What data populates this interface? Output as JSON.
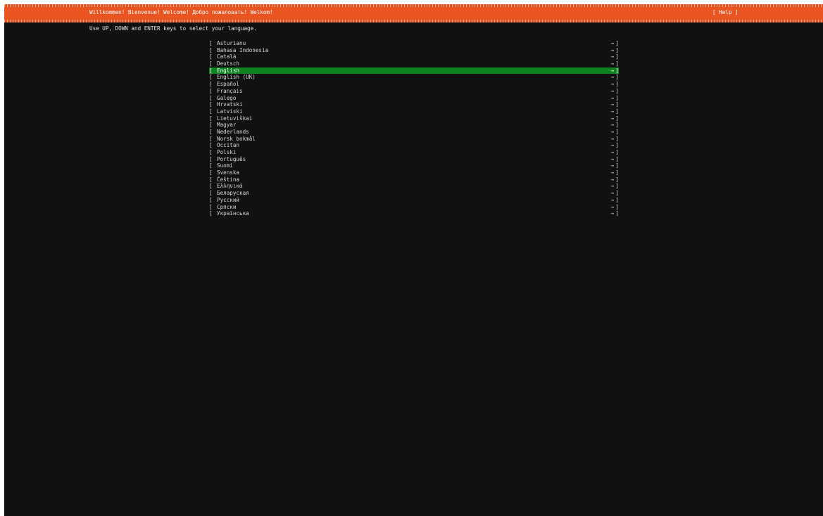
{
  "header": {
    "title": "Willkommen! Bienvenue! Welcome! Добро пожаловать! Welkom!",
    "help_label": "[ Help ]"
  },
  "instructions": "Use UP, DOWN and ENTER keys to select your language.",
  "list_markers": {
    "open_bracket": "[",
    "close_bracket": "]",
    "arrow": "→"
  },
  "languages": [
    {
      "label": "Asturianu",
      "selected": false
    },
    {
      "label": "Bahasa Indonesia",
      "selected": false
    },
    {
      "label": "Català",
      "selected": false
    },
    {
      "label": "Deutsch",
      "selected": false
    },
    {
      "label": "English",
      "selected": true
    },
    {
      "label": "English (UK)",
      "selected": false
    },
    {
      "label": "Español",
      "selected": false
    },
    {
      "label": "Français",
      "selected": false
    },
    {
      "label": "Galego",
      "selected": false
    },
    {
      "label": "Hrvatski",
      "selected": false
    },
    {
      "label": "Latviski",
      "selected": false
    },
    {
      "label": "Lietuviškai",
      "selected": false
    },
    {
      "label": "Magyar",
      "selected": false
    },
    {
      "label": "Nederlands",
      "selected": false
    },
    {
      "label": "Norsk bokmål",
      "selected": false
    },
    {
      "label": "Occitan",
      "selected": false
    },
    {
      "label": "Polski",
      "selected": false
    },
    {
      "label": "Português",
      "selected": false
    },
    {
      "label": "Suomi",
      "selected": false
    },
    {
      "label": "Svenska",
      "selected": false
    },
    {
      "label": "Čeština",
      "selected": false
    },
    {
      "label": "Ελληνικά",
      "selected": false
    },
    {
      "label": "Беларуская",
      "selected": false
    },
    {
      "label": "Русский",
      "selected": false
    },
    {
      "label": "Српски",
      "selected": false
    },
    {
      "label": "Українська",
      "selected": false
    }
  ],
  "colors": {
    "header_background": "#e95420",
    "selection_background": "#0e8420",
    "screen_background": "#111111",
    "text": "#d7d7d7"
  }
}
